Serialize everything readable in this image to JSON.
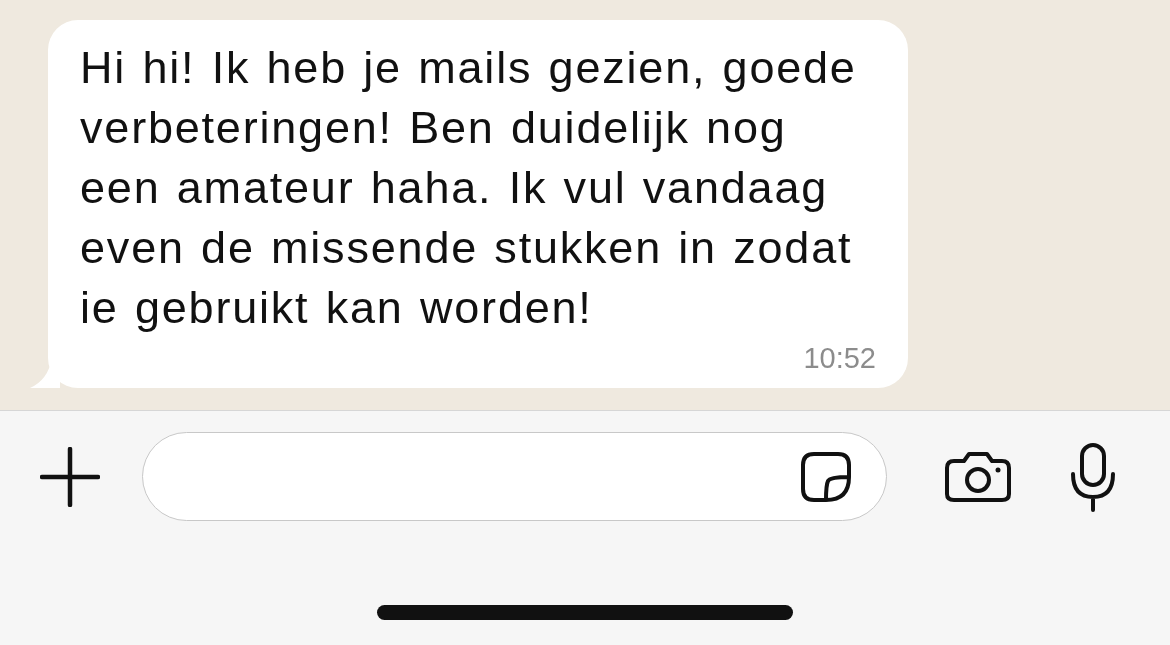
{
  "messages": [
    {
      "text": "Hi hi! Ik heb je mails gezien, goede verbeteringen! Ben duidelijk nog een amateur haha. Ik vul vandaag even de missende stukken in zodat ie gebruikt kan worden!",
      "time": "10:52"
    }
  ]
}
